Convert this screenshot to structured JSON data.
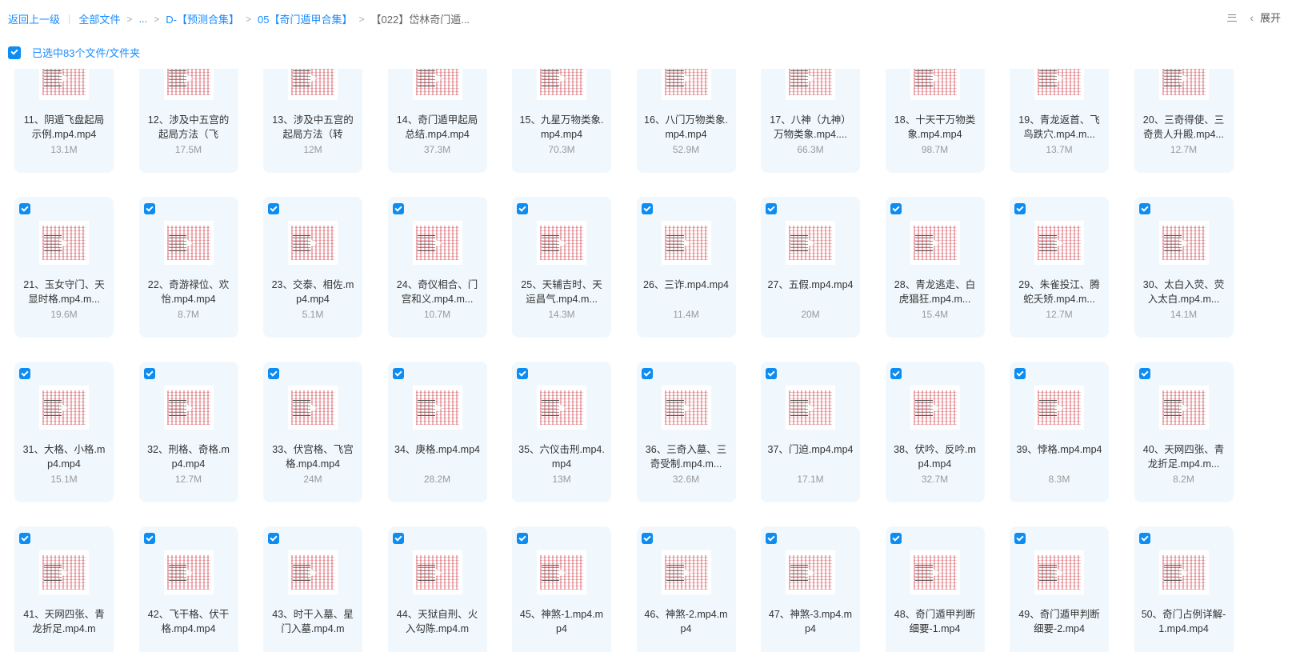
{
  "breadcrumb": {
    "back": "返回上一级",
    "all_files": "全部文件",
    "ellipsis": "...",
    "path": [
      "D-【预测合集】",
      "05【奇门遁甲合集】"
    ],
    "current": "【022】岱林奇门遁..."
  },
  "toolbar": {
    "expand": "展开"
  },
  "selection": {
    "label": "已选中83个文件/文件夹"
  },
  "files": [
    {
      "name": "11、阴遁飞盘起局示例.mp4.mp4",
      "size": "13.1M",
      "checked": false
    },
    {
      "name": "12、涉及中五宫的起局方法（飞",
      "size": "17.5M",
      "checked": false
    },
    {
      "name": "13、涉及中五宫的起局方法（转",
      "size": "12M",
      "checked": false
    },
    {
      "name": "14、奇门遁甲起局总结.mp4.mp4",
      "size": "37.3M",
      "checked": false
    },
    {
      "name": "15、九星万物类象.mp4.mp4",
      "size": "70.3M",
      "checked": false
    },
    {
      "name": "16、八门万物类象.mp4.mp4",
      "size": "52.9M",
      "checked": false
    },
    {
      "name": "17、八神（九神）万物类象.mp4....",
      "size": "66.3M",
      "checked": false
    },
    {
      "name": "18、十天干万物类象.mp4.mp4",
      "size": "98.7M",
      "checked": false
    },
    {
      "name": "19、青龙返首、飞鸟跌穴.mp4.m...",
      "size": "13.7M",
      "checked": false
    },
    {
      "name": "20、三奇得使、三奇贵人升殿.mp4...",
      "size": "12.7M",
      "checked": false
    },
    {
      "name": "21、玉女守门、天显时格.mp4.m...",
      "size": "19.6M",
      "checked": true
    },
    {
      "name": "22、奇游禄位、欢怡.mp4.mp4",
      "size": "8.7M",
      "checked": true
    },
    {
      "name": "23、交泰、相佐.mp4.mp4",
      "size": "5.1M",
      "checked": true
    },
    {
      "name": "24、奇仪相合、门宫和义.mp4.m...",
      "size": "10.7M",
      "checked": true
    },
    {
      "name": "25、天辅吉时、天运昌气.mp4.m...",
      "size": "14.3M",
      "checked": true
    },
    {
      "name": "26、三诈.mp4.mp4",
      "size": "11.4M",
      "checked": true
    },
    {
      "name": "27、五假.mp4.mp4",
      "size": "20M",
      "checked": true
    },
    {
      "name": "28、青龙逃走、白虎猖狂.mp4.m...",
      "size": "15.4M",
      "checked": true
    },
    {
      "name": "29、朱雀投江、腾蛇夭矫.mp4.m...",
      "size": "12.7M",
      "checked": true
    },
    {
      "name": "30、太白入荧、荧入太白.mp4.m...",
      "size": "14.1M",
      "checked": true
    },
    {
      "name": "31、大格、小格.mp4.mp4",
      "size": "15.1M",
      "checked": true
    },
    {
      "name": "32、刑格、奇格.mp4.mp4",
      "size": "12.7M",
      "checked": true
    },
    {
      "name": "33、伏宫格、飞宫格.mp4.mp4",
      "size": "24M",
      "checked": true
    },
    {
      "name": "34、庚格.mp4.mp4",
      "size": "28.2M",
      "checked": true
    },
    {
      "name": "35、六仪击刑.mp4.mp4",
      "size": "13M",
      "checked": true
    },
    {
      "name": "36、三奇入墓、三奇受制.mp4.m...",
      "size": "32.6M",
      "checked": true
    },
    {
      "name": "37、门迫.mp4.mp4",
      "size": "17.1M",
      "checked": true
    },
    {
      "name": "38、伏吟、反吟.mp4.mp4",
      "size": "32.7M",
      "checked": true
    },
    {
      "name": "39、悖格.mp4.mp4",
      "size": "8.3M",
      "checked": true
    },
    {
      "name": "40、天网四张、青龙折足.mp4.m...",
      "size": "8.2M",
      "checked": true
    },
    {
      "name": "41、天网四张、青龙折足.mp4.m",
      "size": "",
      "checked": true
    },
    {
      "name": "42、飞干格、伏干格.mp4.mp4",
      "size": "",
      "checked": true
    },
    {
      "name": "43、时干入墓、星门入墓.mp4.m",
      "size": "",
      "checked": true
    },
    {
      "name": "44、天狱自刑、火入勾陈.mp4.m",
      "size": "",
      "checked": true
    },
    {
      "name": "45、神煞-1.mp4.mp4",
      "size": "",
      "checked": true
    },
    {
      "name": "46、神煞-2.mp4.mp4",
      "size": "",
      "checked": true
    },
    {
      "name": "47、神煞-3.mp4.mp4",
      "size": "",
      "checked": true
    },
    {
      "name": "48、奇门遁甲判断细要-1.mp4",
      "size": "",
      "checked": true
    },
    {
      "name": "49、奇门遁甲判断细要-2.mp4",
      "size": "",
      "checked": true
    },
    {
      "name": "50、奇门占例详解-1.mp4.mp4",
      "size": "",
      "checked": true
    }
  ]
}
